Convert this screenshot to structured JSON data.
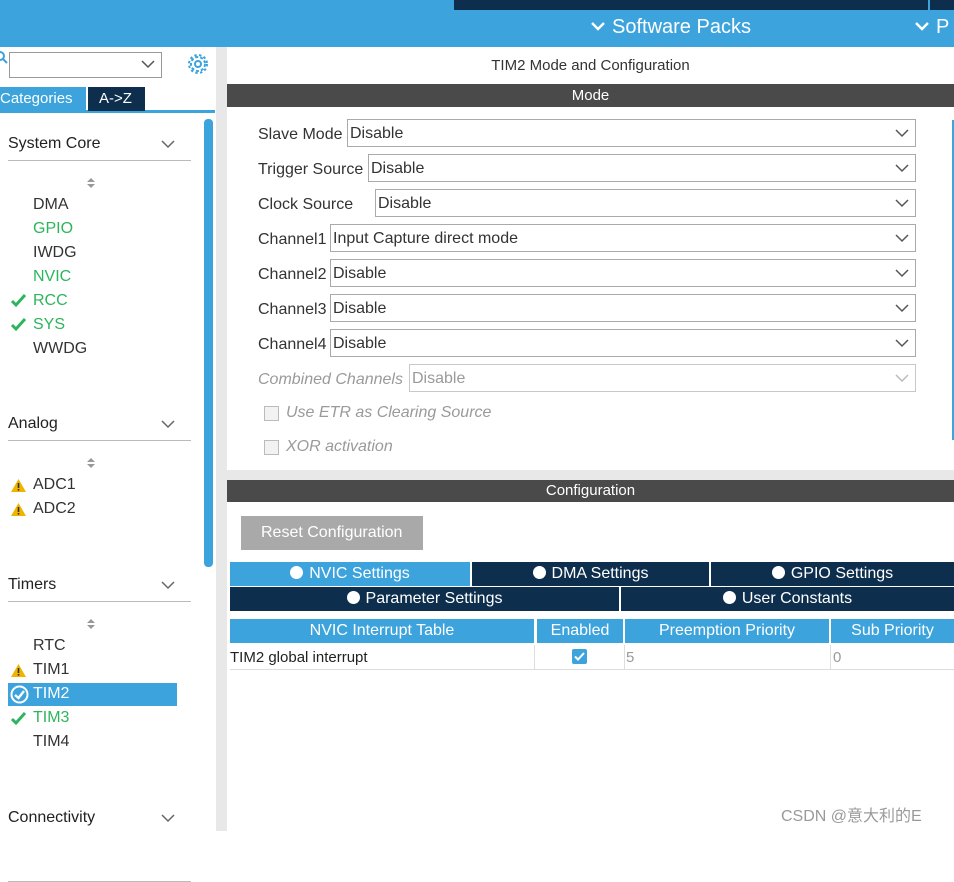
{
  "header": {
    "software_packs": "Software Packs",
    "right_cut": "P"
  },
  "left_panel": {
    "tabs": [
      "Categories",
      "A->Z"
    ],
    "categories": [
      {
        "name": "System Core",
        "items": [
          {
            "label": "DMA",
            "status": "none"
          },
          {
            "label": "GPIO",
            "status": "green"
          },
          {
            "label": "IWDG",
            "status": "none"
          },
          {
            "label": "NVIC",
            "status": "green"
          },
          {
            "label": "RCC",
            "status": "ok"
          },
          {
            "label": "SYS",
            "status": "ok"
          },
          {
            "label": "WWDG",
            "status": "none"
          }
        ]
      },
      {
        "name": "Analog",
        "items": [
          {
            "label": "ADC1",
            "status": "warning"
          },
          {
            "label": "ADC2",
            "status": "warning"
          }
        ]
      },
      {
        "name": "Timers",
        "items": [
          {
            "label": "RTC",
            "status": "none"
          },
          {
            "label": "TIM1",
            "status": "warning"
          },
          {
            "label": "TIM2",
            "status": "selected"
          },
          {
            "label": "TIM3",
            "status": "ok"
          },
          {
            "label": "TIM4",
            "status": "none"
          }
        ]
      },
      {
        "name": "Connectivity",
        "items": []
      }
    ]
  },
  "main": {
    "title": "TIM2 Mode and Configuration",
    "mode_header": "Mode",
    "mode_fields": [
      {
        "label": "Slave Mode",
        "value": "Disable"
      },
      {
        "label": "Trigger Source",
        "value": "Disable"
      },
      {
        "label": "Clock Source",
        "value": "Disable"
      },
      {
        "label": "Channel1",
        "value": "Input Capture direct mode"
      },
      {
        "label": "Channel2",
        "value": "Disable"
      },
      {
        "label": "Channel3",
        "value": "Disable"
      },
      {
        "label": "Channel4",
        "value": "Disable"
      },
      {
        "label": "Combined Channels",
        "value": "Disable"
      }
    ],
    "checkboxes": [
      "Use ETR as Clearing Source",
      "XOR activation"
    ],
    "config_header": "Configuration",
    "reset_button": "Reset Configuration",
    "tabs_row1": [
      "NVIC Settings",
      "DMA Settings",
      "GPIO Settings"
    ],
    "tabs_row2": [
      "Parameter Settings",
      "User Constants"
    ],
    "table": {
      "headers": [
        "NVIC Interrupt Table",
        "Enabled",
        "Preemption Priority",
        "Sub Priority"
      ],
      "rows": [
        {
          "name": "TIM2 global interrupt",
          "enabled": true,
          "preemption": "5",
          "sub": "0"
        }
      ]
    }
  },
  "watermark": "CSDN @意大利的E",
  "colors": {
    "accent": "#3ca3dc",
    "dark": "#0d2e4d",
    "green": "#2db55d",
    "warning": "#f0b400"
  }
}
